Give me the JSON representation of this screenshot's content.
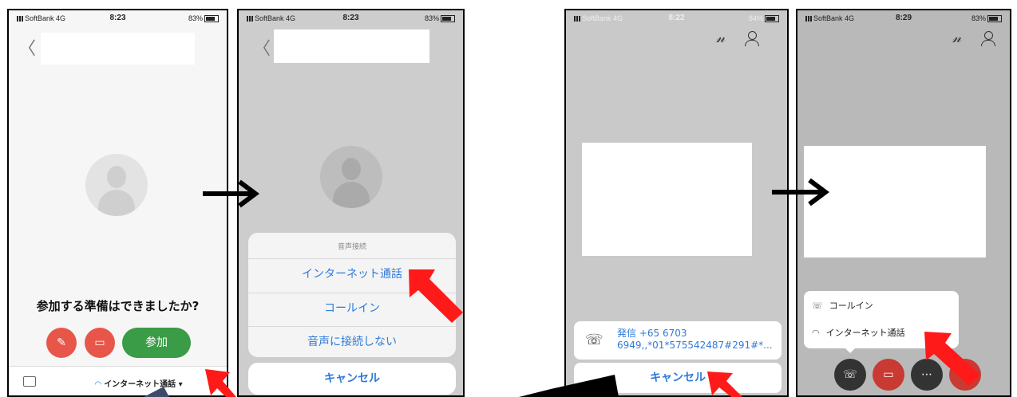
{
  "status": {
    "p1": {
      "carrier": "SoftBank  4G",
      "time": "8:23",
      "battery": "83%"
    },
    "p2": {
      "carrier": "SoftBank  4G",
      "time": "8:23",
      "battery": "83%"
    },
    "p3": {
      "carrier": "SoftBank  4G",
      "time": "8:22",
      "battery": "84%"
    },
    "p4": {
      "carrier": "SoftBank  4G",
      "time": "8:29",
      "battery": "83%"
    }
  },
  "phone1": {
    "back": "〈",
    "question": "参加する準備はできましたか?",
    "join_label": "参加",
    "audio_label": "インターネット通話",
    "audio_caret": "▾"
  },
  "phone2": {
    "back": "〈",
    "sheet_title": "音声接続",
    "options": [
      "インターネット通話",
      "コールイン",
      "音声に接続しない"
    ],
    "cancel": "キャンセル"
  },
  "phone3": {
    "call_line1": "発信 +65 6703",
    "call_line2": "6949,,*01*575542487#291#*...",
    "cancel": "キャンセル"
  },
  "phone4": {
    "menu": [
      "コールイン",
      "インターネット通話"
    ]
  },
  "colors": {
    "accent_red": "#e8443a",
    "join_green": "#3a9c46",
    "link_blue": "#2f7ad8",
    "arrow_red": "#ff1a1a"
  }
}
